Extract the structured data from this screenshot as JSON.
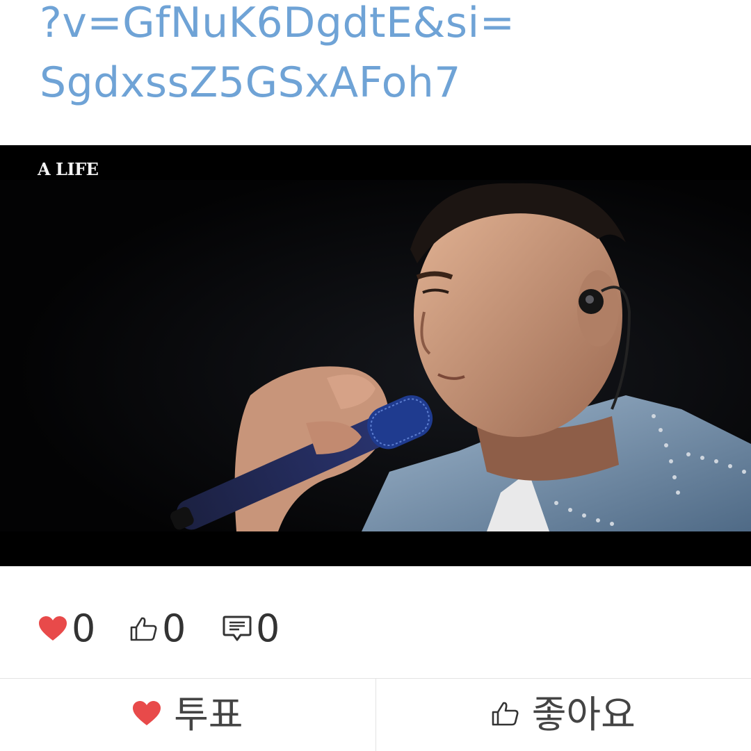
{
  "post": {
    "link_line_1": "?v=GfNuK6DgdtE&si=",
    "link_line_2": "SgdxssZ5GSxAFoh7"
  },
  "video": {
    "caption": "A LIFE",
    "icon": "video-thumbnail"
  },
  "stats": {
    "votes": "0",
    "votes_icon": "heart-icon",
    "likes": "0",
    "likes_icon": "thumbs-up-icon",
    "comments": "0",
    "comments_icon": "comment-icon"
  },
  "actions": {
    "vote_label": "투표",
    "vote_icon": "heart-icon",
    "like_label": "좋아요",
    "like_icon": "thumbs-up-icon"
  },
  "colors": {
    "link": "#6fa3d6",
    "heart": "#e84a4a",
    "text": "#333333",
    "divider": "#e3e3e3"
  }
}
